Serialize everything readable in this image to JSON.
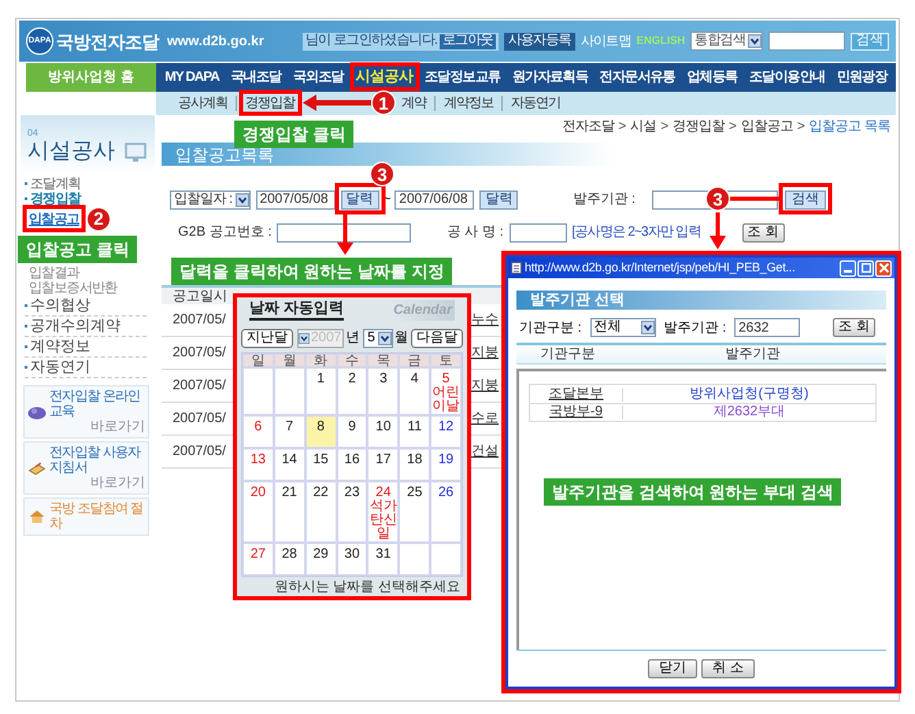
{
  "header": {
    "logo_badge": "DAPA",
    "logo": "국방전자조달",
    "url": "www.d2b.go.kr",
    "login_message": "님이 로그인하셨습니다.",
    "logout_button": "로그아웃",
    "register_button": "사용자등록",
    "sitemap_link": "사이트맵",
    "english_link": "ENGLISH",
    "search_scope": "통합검색",
    "search_button": "검색"
  },
  "nav": {
    "home": "방위사업청 홈",
    "items": [
      {
        "label": "MY DAPA",
        "selected": false
      },
      {
        "label": "국내조달",
        "selected": false
      },
      {
        "label": "국외조달",
        "selected": false
      },
      {
        "label": "시설공사",
        "selected": true
      },
      {
        "label": "조달정보교류",
        "selected": false
      },
      {
        "label": "원가자료획득",
        "selected": false
      },
      {
        "label": "전자문서유통",
        "selected": false
      },
      {
        "label": "업체등록",
        "selected": false
      },
      {
        "label": "조달이용안내",
        "selected": false
      },
      {
        "label": "민원광장",
        "selected": false
      }
    ]
  },
  "subnav": [
    "공사계획",
    "경쟁입찰",
    "계약",
    "계약정보",
    "자동연기"
  ],
  "breadcrumb": {
    "separator": ">",
    "items": [
      {
        "label": "전자조달",
        "current": false
      },
      {
        "label": "시설",
        "current": false
      },
      {
        "label": "경쟁입찰",
        "current": false
      },
      {
        "label": "입찰공고",
        "current": false
      },
      {
        "label": "입찰공고 목록",
        "current": true
      }
    ]
  },
  "sidebar": {
    "number": "04",
    "title": "시설공사",
    "items": [
      {
        "label": "조달계획",
        "selected": false
      },
      {
        "label": "경쟁입찰",
        "selected": false,
        "children": [
          {
            "label": "입찰공고",
            "selected": true
          },
          {
            "label": "입찰결과",
            "selected": false
          },
          {
            "label": "입찰보증서반환",
            "selected": false
          }
        ]
      }
    ],
    "menu": [
      "수의협상",
      "공개수의계약",
      "계약정보",
      "자동연기"
    ],
    "banners": [
      {
        "title": "전자입찰 온라인 교육",
        "link": "바로가기"
      },
      {
        "title": "전자입찰 사용자 지침서",
        "link": "바로가기"
      },
      {
        "title": "국방 조달참여 절차"
      }
    ]
  },
  "main": {
    "title": "입찰공고목록",
    "search": {
      "date_label": "입찰일자 :",
      "date_from": "2007/05/08",
      "date_from_button": "달력",
      "tilde": "~",
      "date_to": "2007/06/08",
      "date_to_button": "달력",
      "agency_label": "발주기관 :",
      "agency_button": "검색",
      "notice_label": "G2B 공고번호 :",
      "name_label": "공 사 명 :",
      "name_hint": "[공사명은 2~3자만 입력",
      "query_button": "조 회"
    },
    "table": {
      "columns": [
        "공고일시"
      ],
      "rows": [
        {
          "date": "2007/05/",
          "title": "누수"
        },
        {
          "date": "2007/05/",
          "title": "지붕"
        },
        {
          "date": "2007/05/",
          "title": "지붕"
        },
        {
          "date": "2007/05/",
          "title": "수로"
        },
        {
          "date": "2007/05/",
          "title": "건설"
        }
      ]
    }
  },
  "calendar": {
    "title": "날짜 자동입력",
    "brand": "Calendar",
    "prev_button": "지난달",
    "year": "2007",
    "year_unit": "년",
    "month": "5",
    "month_unit": "월",
    "next_button": "다음달",
    "weekdays": [
      "일",
      "월",
      "화",
      "수",
      "목",
      "금",
      "토"
    ],
    "weeks": [
      [
        {
          "kind": "blank"
        },
        {
          "kind": "blank"
        },
        {
          "kind": "day",
          "day": "1",
          "selected": false
        },
        {
          "kind": "day",
          "day": "2",
          "selected": false
        },
        {
          "kind": "day",
          "day": "3",
          "selected": false
        },
        {
          "kind": "day",
          "day": "4",
          "selected": false
        },
        {
          "kind": "day",
          "day": "5",
          "selected": false,
          "holiday": "어린이날"
        }
      ],
      [
        {
          "kind": "day",
          "day": "6",
          "selected": false
        },
        {
          "kind": "day",
          "day": "7",
          "selected": false
        },
        {
          "kind": "day",
          "day": "8",
          "selected": true
        },
        {
          "kind": "day",
          "day": "9",
          "selected": false
        },
        {
          "kind": "day",
          "day": "10",
          "selected": false
        },
        {
          "kind": "day",
          "day": "11",
          "selected": false
        },
        {
          "kind": "day",
          "day": "12",
          "selected": false
        }
      ],
      [
        {
          "kind": "day",
          "day": "13",
          "selected": false
        },
        {
          "kind": "day",
          "day": "14",
          "selected": false
        },
        {
          "kind": "day",
          "day": "15",
          "selected": false
        },
        {
          "kind": "day",
          "day": "16",
          "selected": false
        },
        {
          "kind": "day",
          "day": "17",
          "selected": false
        },
        {
          "kind": "day",
          "day": "18",
          "selected": false
        },
        {
          "kind": "day",
          "day": "19",
          "selected": false
        }
      ],
      [
        {
          "kind": "day",
          "day": "20",
          "selected": false
        },
        {
          "kind": "day",
          "day": "21",
          "selected": false
        },
        {
          "kind": "day",
          "day": "22",
          "selected": false
        },
        {
          "kind": "day",
          "day": "23",
          "selected": false
        },
        {
          "kind": "day",
          "day": "24",
          "selected": false,
          "holiday": "석가탄신일"
        },
        {
          "kind": "day",
          "day": "25",
          "selected": false
        },
        {
          "kind": "day",
          "day": "26",
          "selected": false
        }
      ],
      [
        {
          "kind": "day",
          "day": "27",
          "selected": false
        },
        {
          "kind": "day",
          "day": "28",
          "selected": false
        },
        {
          "kind": "day",
          "day": "29",
          "selected": false
        },
        {
          "kind": "day",
          "day": "30",
          "selected": false
        },
        {
          "kind": "day",
          "day": "31",
          "selected": false
        },
        {
          "kind": "blank"
        },
        {
          "kind": "blank"
        }
      ]
    ],
    "footer": "원하시는 날짜를 선택해주세요"
  },
  "popup": {
    "url": "http://www.d2b.go.kr/Internet/jsp/peb/HI_PEB_Get...",
    "heading": "발주기관 선택",
    "type_label": "기관구분 :",
    "type_value": "전체",
    "agency_label": "발주기관 :",
    "agency_value": "2632",
    "query_button": "조 회",
    "columns": [
      "기관구분",
      "발주기관"
    ],
    "rows": [
      {
        "type": "조달본부",
        "agency": "방위사업청(구명청)",
        "visited": false
      },
      {
        "type": "국방부-9",
        "agency": "제2632부대",
        "visited": true
      }
    ],
    "close_button": "닫기",
    "cancel_button": "취 소"
  },
  "annotations": {
    "steps": [
      "1",
      "2",
      "3",
      "3"
    ],
    "callouts": [
      "경쟁입찰 클릭",
      "입찰공고 클릭",
      "달력을 클릭하여 원하는 날짜를 지정",
      "발주기관을 검색하여 원하는 부대 검색"
    ]
  }
}
